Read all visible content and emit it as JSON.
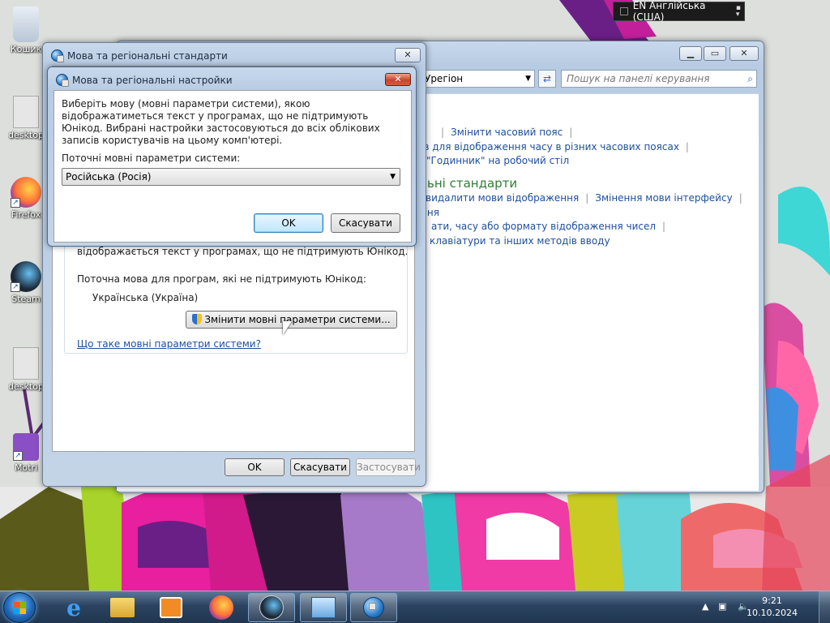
{
  "desktop": {
    "icons": [
      {
        "label": "Кошик",
        "icon": "recycle-bin-icon"
      },
      {
        "label": "desktop",
        "icon": "settings-file-icon"
      },
      {
        "label": "Firefox",
        "icon": "firefox-icon"
      },
      {
        "label": "Steam",
        "icon": "steam-icon"
      },
      {
        "label": "desktop",
        "icon": "settings-file-icon"
      },
      {
        "label": "Motri",
        "icon": "app-shortcut-icon"
      }
    ]
  },
  "langbar": {
    "text": "EN Англійська (США)"
  },
  "control_panel": {
    "address_tail": "Урегіон",
    "search_placeholder": "Пошук на панелі керування",
    "links": {
      "change_timezone": "Змінити часовий пояс",
      "clocks_for_timezones": "ів для відображення часу в різних часових поясах",
      "gadget_clock": "\"Годинник\" на робочий стіл",
      "regional_heading": "ьні стандарти",
      "remove_display_lang": "видалити мови відображення",
      "change_ui_lang": "Змінення мови інтерфейсу",
      "frag1": "ння",
      "date_time_format": "ати, часу або формату відображення чисел",
      "keyboard_methods": "клавіатури та інших методів вводу"
    }
  },
  "regional_dialog": {
    "title": "Мова та регіональні стандарти",
    "partial_text": "відображається текст у програмах, що не підтримують Юнікод.",
    "current_lang_label": "Поточна мова для програм, які не підтримують Юнікод:",
    "current_lang_value": "Українська (Україна)",
    "change_button": "Змінити мовні параметри системи...",
    "help_link": "Що таке мовні параметри системи?",
    "ok": "OK",
    "cancel": "Скасувати",
    "apply": "Застосувати"
  },
  "system_locale_dialog": {
    "title": "Мова та регіональні настройки",
    "description": "Виберіть мову (мовні параметри системи), якою відображатиметься текст у програмах, що не підтримують Юнікод. Вибрані настройки застосовуються до всіх облікових записів користувачів на цьому комп'ютері.",
    "locale_label": "Поточні мовні параметри системи:",
    "locale_value": "Російська (Росія)",
    "ok": "OK",
    "cancel": "Скасувати"
  },
  "taskbar": {
    "time": "9:21",
    "date": "10.10.2024"
  },
  "colors": {
    "link": "#1d4f9c",
    "heading_green": "#2e7d32",
    "taskbar": "#2c4460"
  }
}
